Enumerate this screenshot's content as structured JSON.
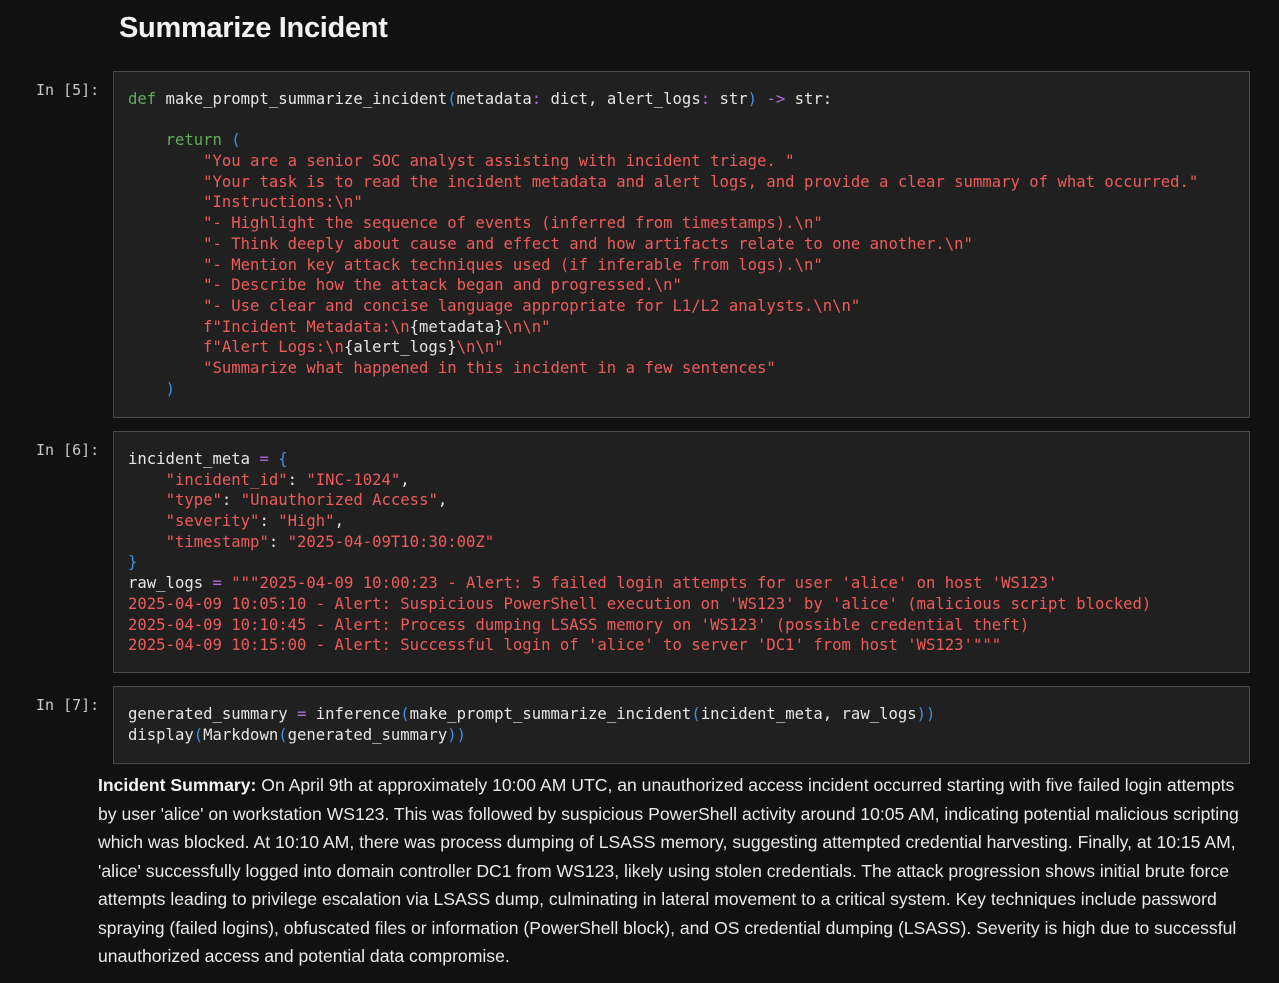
{
  "heading": "Summarize Incident",
  "cells": [
    {
      "prompt": "In [5]:",
      "lines": [
        [
          [
            "kw",
            "def"
          ],
          [
            "tx",
            " make_prompt_summarize_incident"
          ],
          [
            "pun",
            "("
          ],
          [
            "tx",
            "metadata"
          ],
          [
            "op",
            ":"
          ],
          [
            "tx",
            " dict, alert_logs"
          ],
          [
            "op",
            ":"
          ],
          [
            "tx",
            " str"
          ],
          [
            "pun",
            ")"
          ],
          [
            "tx",
            " "
          ],
          [
            "op",
            "->"
          ],
          [
            "tx",
            " str:"
          ]
        ],
        [
          [
            "tx",
            ""
          ]
        ],
        [
          [
            "tx",
            "    "
          ],
          [
            "kw",
            "return"
          ],
          [
            "tx",
            " "
          ],
          [
            "pun",
            "("
          ]
        ],
        [
          [
            "tx",
            "        "
          ],
          [
            "str",
            "\"You are a senior SOC analyst assisting with incident triage. \""
          ]
        ],
        [
          [
            "tx",
            "        "
          ],
          [
            "str",
            "\"Your task is to read the incident metadata and alert logs, and provide a clear summary of what occurred.\""
          ]
        ],
        [
          [
            "tx",
            "        "
          ],
          [
            "str",
            "\"Instructions:\\n\""
          ]
        ],
        [
          [
            "tx",
            "        "
          ],
          [
            "str",
            "\"- Highlight the sequence of events (inferred from timestamps).\\n\""
          ]
        ],
        [
          [
            "tx",
            "        "
          ],
          [
            "str",
            "\"- Think deeply about cause and effect and how artifacts relate to one another.\\n\""
          ]
        ],
        [
          [
            "tx",
            "        "
          ],
          [
            "str",
            "\"- Mention key attack techniques used (if inferable from logs).\\n\""
          ]
        ],
        [
          [
            "tx",
            "        "
          ],
          [
            "str",
            "\"- Describe how the attack began and progressed.\\n\""
          ]
        ],
        [
          [
            "tx",
            "        "
          ],
          [
            "str",
            "\"- Use clear and concise language appropriate for L1/L2 analysts.\\n\\n\""
          ]
        ],
        [
          [
            "tx",
            "        "
          ],
          [
            "str",
            "f\"Incident Metadata:\\n"
          ],
          [
            "tx",
            "{metadata}"
          ],
          [
            "str",
            "\\n\\n\""
          ]
        ],
        [
          [
            "tx",
            "        "
          ],
          [
            "str",
            "f\"Alert Logs:\\n"
          ],
          [
            "tx",
            "{alert_logs}"
          ],
          [
            "str",
            "\\n\\n\""
          ]
        ],
        [
          [
            "tx",
            "        "
          ],
          [
            "str",
            "\"Summarize what happened in this incident in a few sentences\""
          ]
        ],
        [
          [
            "tx",
            "    "
          ],
          [
            "pun",
            ")"
          ]
        ]
      ]
    },
    {
      "prompt": "In [6]:",
      "lines": [
        [
          [
            "tx",
            "incident_meta "
          ],
          [
            "op",
            "="
          ],
          [
            "tx",
            " "
          ],
          [
            "pun",
            "{"
          ]
        ],
        [
          [
            "tx",
            "    "
          ],
          [
            "str",
            "\"incident_id\""
          ],
          [
            "tx",
            ": "
          ],
          [
            "str",
            "\"INC-1024\""
          ],
          [
            "tx",
            ","
          ]
        ],
        [
          [
            "tx",
            "    "
          ],
          [
            "str",
            "\"type\""
          ],
          [
            "tx",
            ": "
          ],
          [
            "str",
            "\"Unauthorized Access\""
          ],
          [
            "tx",
            ","
          ]
        ],
        [
          [
            "tx",
            "    "
          ],
          [
            "str",
            "\"severity\""
          ],
          [
            "tx",
            ": "
          ],
          [
            "str",
            "\"High\""
          ],
          [
            "tx",
            ","
          ]
        ],
        [
          [
            "tx",
            "    "
          ],
          [
            "str",
            "\"timestamp\""
          ],
          [
            "tx",
            ": "
          ],
          [
            "str",
            "\"2025-04-09T10:30:00Z\""
          ]
        ],
        [
          [
            "pun",
            "}"
          ]
        ],
        [
          [
            "tx",
            "raw_logs "
          ],
          [
            "op",
            "="
          ],
          [
            "tx",
            " "
          ],
          [
            "str",
            "\"\"\"2025-04-09 10:00:23 - Alert: 5 failed login attempts for user 'alice' on host 'WS123'"
          ]
        ],
        [
          [
            "str",
            "2025-04-09 10:05:10 - Alert: Suspicious PowerShell execution on 'WS123' by 'alice' (malicious script blocked)"
          ]
        ],
        [
          [
            "str",
            "2025-04-09 10:10:45 - Alert: Process dumping LSASS memory on 'WS123' (possible credential theft)"
          ]
        ],
        [
          [
            "str",
            "2025-04-09 10:15:00 - Alert: Successful login of 'alice' to server 'DC1' from host 'WS123'\"\"\""
          ]
        ]
      ]
    },
    {
      "prompt": "In [7]:",
      "lines": [
        [
          [
            "tx",
            "generated_summary "
          ],
          [
            "op",
            "="
          ],
          [
            "tx",
            " inference"
          ],
          [
            "pun",
            "("
          ],
          [
            "tx",
            "make_prompt_summarize_incident"
          ],
          [
            "pun",
            "("
          ],
          [
            "tx",
            "incident_meta, raw_logs"
          ],
          [
            "pun",
            "))"
          ]
        ],
        [
          [
            "tx",
            "display"
          ],
          [
            "pun",
            "("
          ],
          [
            "tx",
            "Markdown"
          ],
          [
            "pun",
            "("
          ],
          [
            "tx",
            "generated_summary"
          ],
          [
            "pun",
            "))"
          ]
        ]
      ]
    }
  ],
  "output": {
    "label": "Incident Summary:",
    "text": " On April 9th at approximately 10:00 AM UTC, an unauthorized access incident occurred starting with five failed login attempts by user 'alice' on workstation WS123. This was followed by suspicious PowerShell activity around 10:05 AM, indicating potential malicious scripting which was blocked. At 10:10 AM, there was process dumping of LSASS memory, suggesting attempted credential harvesting. Finally, at 10:15 AM, 'alice' successfully logged into domain controller DC1 from WS123, likely using stolen credentials. The attack progression shows initial brute force attempts leading to privilege escalation via LSASS dump, culminating in lateral movement to a critical system. Key techniques include password spraying (failed logins), obfuscated files or information (PowerShell block), and OS credential dumping (LSASS). Severity is high due to successful unauthorized access and potential data compromise."
  }
}
